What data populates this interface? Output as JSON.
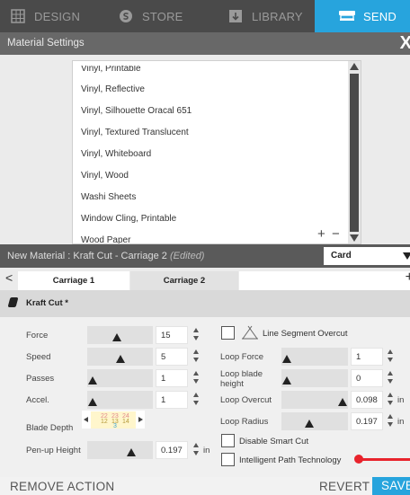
{
  "tabs": [
    {
      "label": "DESIGN",
      "icon": "grid-icon"
    },
    {
      "label": "STORE",
      "icon": "store-icon"
    },
    {
      "label": "LIBRARY",
      "icon": "library-icon"
    },
    {
      "label": "SEND",
      "icon": "cutter-icon",
      "active": true
    }
  ],
  "material_settings": {
    "title": "Material Settings",
    "close": "X",
    "items": [
      "Vinyl, Printable",
      "Vinyl, Reflective",
      "Vinyl, Silhouette Oracal 651",
      "Vinyl, Textured Translucent",
      "Vinyl, Whiteboard",
      "Vinyl, Wood",
      "Washi Sheets",
      "Window Cling, Printable",
      "Wood Paper"
    ],
    "add": "+",
    "remove": "−"
  },
  "new_material": {
    "label": "New Material : Kraft Cut - Carriage 2",
    "edited": "(Edited)",
    "type_select": "Card"
  },
  "carriage": {
    "prev": "<",
    "next": "+",
    "tabs": [
      "Carriage 1",
      "Carriage 2"
    ]
  },
  "tool": {
    "name": "Kraft Cut *"
  },
  "settings": {
    "force": {
      "label": "Force",
      "value": "15",
      "level": 0.45
    },
    "speed": {
      "label": "Speed",
      "value": "5",
      "level": 0.5
    },
    "passes": {
      "label": "Passes",
      "value": "1",
      "level": 0.0
    },
    "accel": {
      "label": "Accel.",
      "value": "1",
      "level": 0.0
    },
    "blade_depth": {
      "label": "Blade Depth",
      "numbers_top": [
        "22",
        "23",
        "24"
      ],
      "numbers_mid": [
        "12",
        "13",
        "14"
      ],
      "numbers_bottom": [
        "3"
      ]
    },
    "penup": {
      "label": "Pen-up Height",
      "value": "0.197",
      "unit": "in",
      "level": 0.7
    },
    "line_segment_overcut": {
      "label": "Line Segment Overcut",
      "checked": false
    },
    "loop_force": {
      "label": "Loop Force",
      "value": "1",
      "level": 0.0
    },
    "loop_blade_height": {
      "label": "Loop blade height",
      "value": "0",
      "level": 0.0
    },
    "loop_overcut": {
      "label": "Loop Overcut",
      "value": "0.098",
      "unit": "in",
      "level": 1.0
    },
    "loop_radius": {
      "label": "Loop Radius",
      "value": "0.197",
      "unit": "in",
      "level": 0.4
    },
    "disable_smart_cut": {
      "label": "Disable Smart Cut",
      "checked": false
    },
    "intelligent_path": {
      "label": "Intelligent Path Technology",
      "checked": false
    }
  },
  "actions": {
    "remove": "REMOVE ACTION",
    "revert": "REVERT",
    "save": "SAVE"
  },
  "colors": {
    "accent": "#27a4dd",
    "topbar": "#4a4a4a",
    "indicator": "#e8232c"
  }
}
